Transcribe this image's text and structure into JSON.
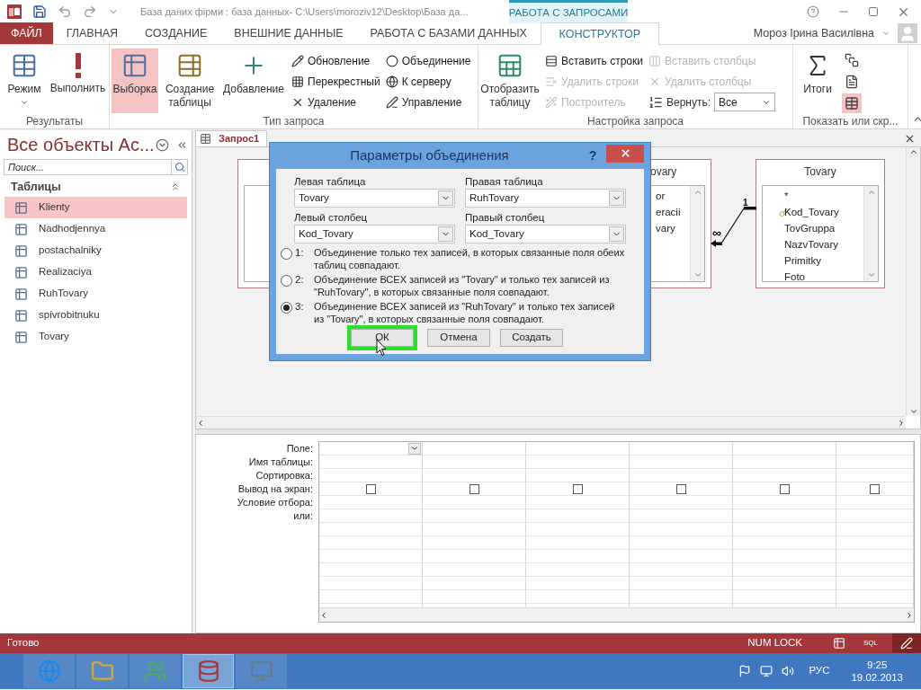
{
  "title_bar": {
    "title": "База даних фірми : база данных- C:\\Users\\moroziv12\\Desktop\\База да...",
    "context_label": "РАБОТА С ЗАПРОСАМИ"
  },
  "ribbon_tabs": [
    {
      "label": "ФАЙЛ",
      "kind": "file",
      "selected": false
    },
    {
      "label": "ГЛАВНАЯ",
      "kind": "tab",
      "selected": false
    },
    {
      "label": "СОЗДАНИЕ",
      "kind": "tab",
      "selected": false
    },
    {
      "label": "ВНЕШНИЕ ДАННЫЕ",
      "kind": "tab",
      "selected": false
    },
    {
      "label": "РАБОТА С БАЗАМИ ДАННЫХ",
      "kind": "tab",
      "selected": false
    },
    {
      "label": "КОНСТРУКТОР",
      "kind": "tab",
      "selected": true
    }
  ],
  "user": "Мороз Ірина Василівна",
  "ribbon_groups": [
    {
      "label": "Результаты",
      "large": [
        {
          "label": "Режим",
          "dropdown": true,
          "selected": false
        },
        {
          "label": "Выполнить",
          "dropdown": false,
          "selected": false
        }
      ]
    },
    {
      "label": "Тип запроса",
      "large": [
        {
          "label": "Выборка",
          "dropdown": false,
          "selected": true
        },
        {
          "label": "Создание таблицы",
          "dropdown": false,
          "selected": false
        },
        {
          "label": "Добавление",
          "dropdown": false,
          "selected": false
        }
      ],
      "small_columns": [
        [
          {
            "kind": "button",
            "label": "Обновление",
            "disabled": false
          },
          {
            "kind": "button",
            "label": "Перекрестный",
            "disabled": false
          },
          {
            "kind": "button",
            "label": "Удаление",
            "disabled": false
          }
        ],
        [
          {
            "kind": "button",
            "label": "Объединение",
            "disabled": false
          },
          {
            "kind": "button",
            "label": "К серверу",
            "disabled": false
          },
          {
            "kind": "button",
            "label": "Управление",
            "disabled": false
          }
        ]
      ]
    },
    {
      "label": "Настройка запроса",
      "large": [
        {
          "label": "Отобразить таблицу",
          "dropdown": false,
          "selected": false
        }
      ],
      "small_columns": [
        [
          {
            "kind": "button",
            "label": "Вставить строки",
            "disabled": false
          },
          {
            "kind": "button",
            "label": "Удалить строки",
            "disabled": true
          },
          {
            "kind": "button",
            "label": "Построитель",
            "disabled": true
          }
        ],
        [
          {
            "kind": "button",
            "label": "Вставить столбцы",
            "disabled": true
          },
          {
            "kind": "button",
            "label": "Удалить столбцы",
            "disabled": true
          },
          {
            "kind": "combo",
            "label": "Вернуть:",
            "value": "Все"
          }
        ]
      ]
    },
    {
      "label": "Показать или скр...",
      "large": [
        {
          "label": "Итоги",
          "dropdown": false,
          "selected": false
        }
      ],
      "icon_column": [
        {
          "selected": false
        },
        {
          "selected": false
        },
        {
          "selected": true
        }
      ]
    }
  ],
  "nav_pane": {
    "title": "Все объекты Ac...",
    "search_placeholder": "Поиск...",
    "section": "Таблицы",
    "items": [
      {
        "label": "Klienty",
        "selected": true
      },
      {
        "label": "Nadhodjennya",
        "selected": false
      },
      {
        "label": "postachalniky",
        "selected": false
      },
      {
        "label": "Realizaciya",
        "selected": false
      },
      {
        "label": "RuhTovary",
        "selected": false
      },
      {
        "label": "spivrobitnuku",
        "selected": false
      },
      {
        "label": "Tovary",
        "selected": false
      }
    ]
  },
  "document_tab": "Запрос1",
  "tables": [
    {
      "title": "ovary",
      "fields": [
        {
          "name": "or",
          "key": false
        },
        {
          "name": "eracii",
          "key": false
        },
        {
          "name": "vary",
          "key": false
        }
      ]
    },
    {
      "title": "Tovary",
      "fields": [
        {
          "name": "*",
          "key": false
        },
        {
          "name": "Kod_Tovary",
          "key": true
        },
        {
          "name": "TovGruppa",
          "key": false
        },
        {
          "name": "NazvTovary",
          "key": false
        },
        {
          "name": "Primitky",
          "key": false
        },
        {
          "name": "Foto",
          "key": false
        }
      ]
    }
  ],
  "relationship": {
    "one_label": "1",
    "many_label": "∞"
  },
  "dialog": {
    "title": "Параметры объединения",
    "help": "?",
    "fields": [
      {
        "label": "Левая таблица",
        "value": "Tovary"
      },
      {
        "label": "Правая таблица",
        "value": "RuhTovary"
      },
      {
        "label": "Левый столбец",
        "value": "Kod_Tovary"
      },
      {
        "label": "Правый столбец",
        "value": "Kod_Tovary"
      }
    ],
    "options": [
      {
        "number": "1:",
        "text": "Объединение только тех записей, в которых связанные поля обеих таблиц совпадают.",
        "selected": false
      },
      {
        "number": "2:",
        "text": "Объединение ВСЕХ записей из \"Tovary\" и только тех записей из \"RuhTovary\", в которых связанные поля совпадают.",
        "selected": false
      },
      {
        "number": "3:",
        "text": "Объединение ВСЕХ записей из \"RuhTovary\" и только тех записей из \"Tovary\", в которых связанные поля совпадают.",
        "selected": true
      }
    ],
    "buttons": [
      {
        "label": "ОК",
        "highlighted": true
      },
      {
        "label": "Отмена",
        "highlighted": false
      },
      {
        "label": "Создать",
        "highlighted": false
      }
    ]
  },
  "grid": {
    "row_labels": [
      "Поле:",
      "Имя таблицы:",
      "Сортировка:",
      "Вывод на экран:",
      "Условие отбора:",
      "или:"
    ],
    "columns": [
      {
        "active": true,
        "show": false
      },
      {
        "active": false,
        "show": false
      },
      {
        "active": false,
        "show": false
      },
      {
        "active": false,
        "show": false
      },
      {
        "active": false,
        "show": false
      },
      {
        "active": false,
        "show": false
      }
    ]
  },
  "status_bar": {
    "text": "Готово",
    "num_lock": "NUM LOCK",
    "sql": "SQL"
  },
  "taskbar": {
    "apps": [
      {
        "selected": false
      },
      {
        "selected": false
      },
      {
        "selected": false
      },
      {
        "selected": true
      },
      {
        "selected": false
      }
    ],
    "language": "РУС",
    "time": "9:25",
    "date": "19.02.2013"
  }
}
